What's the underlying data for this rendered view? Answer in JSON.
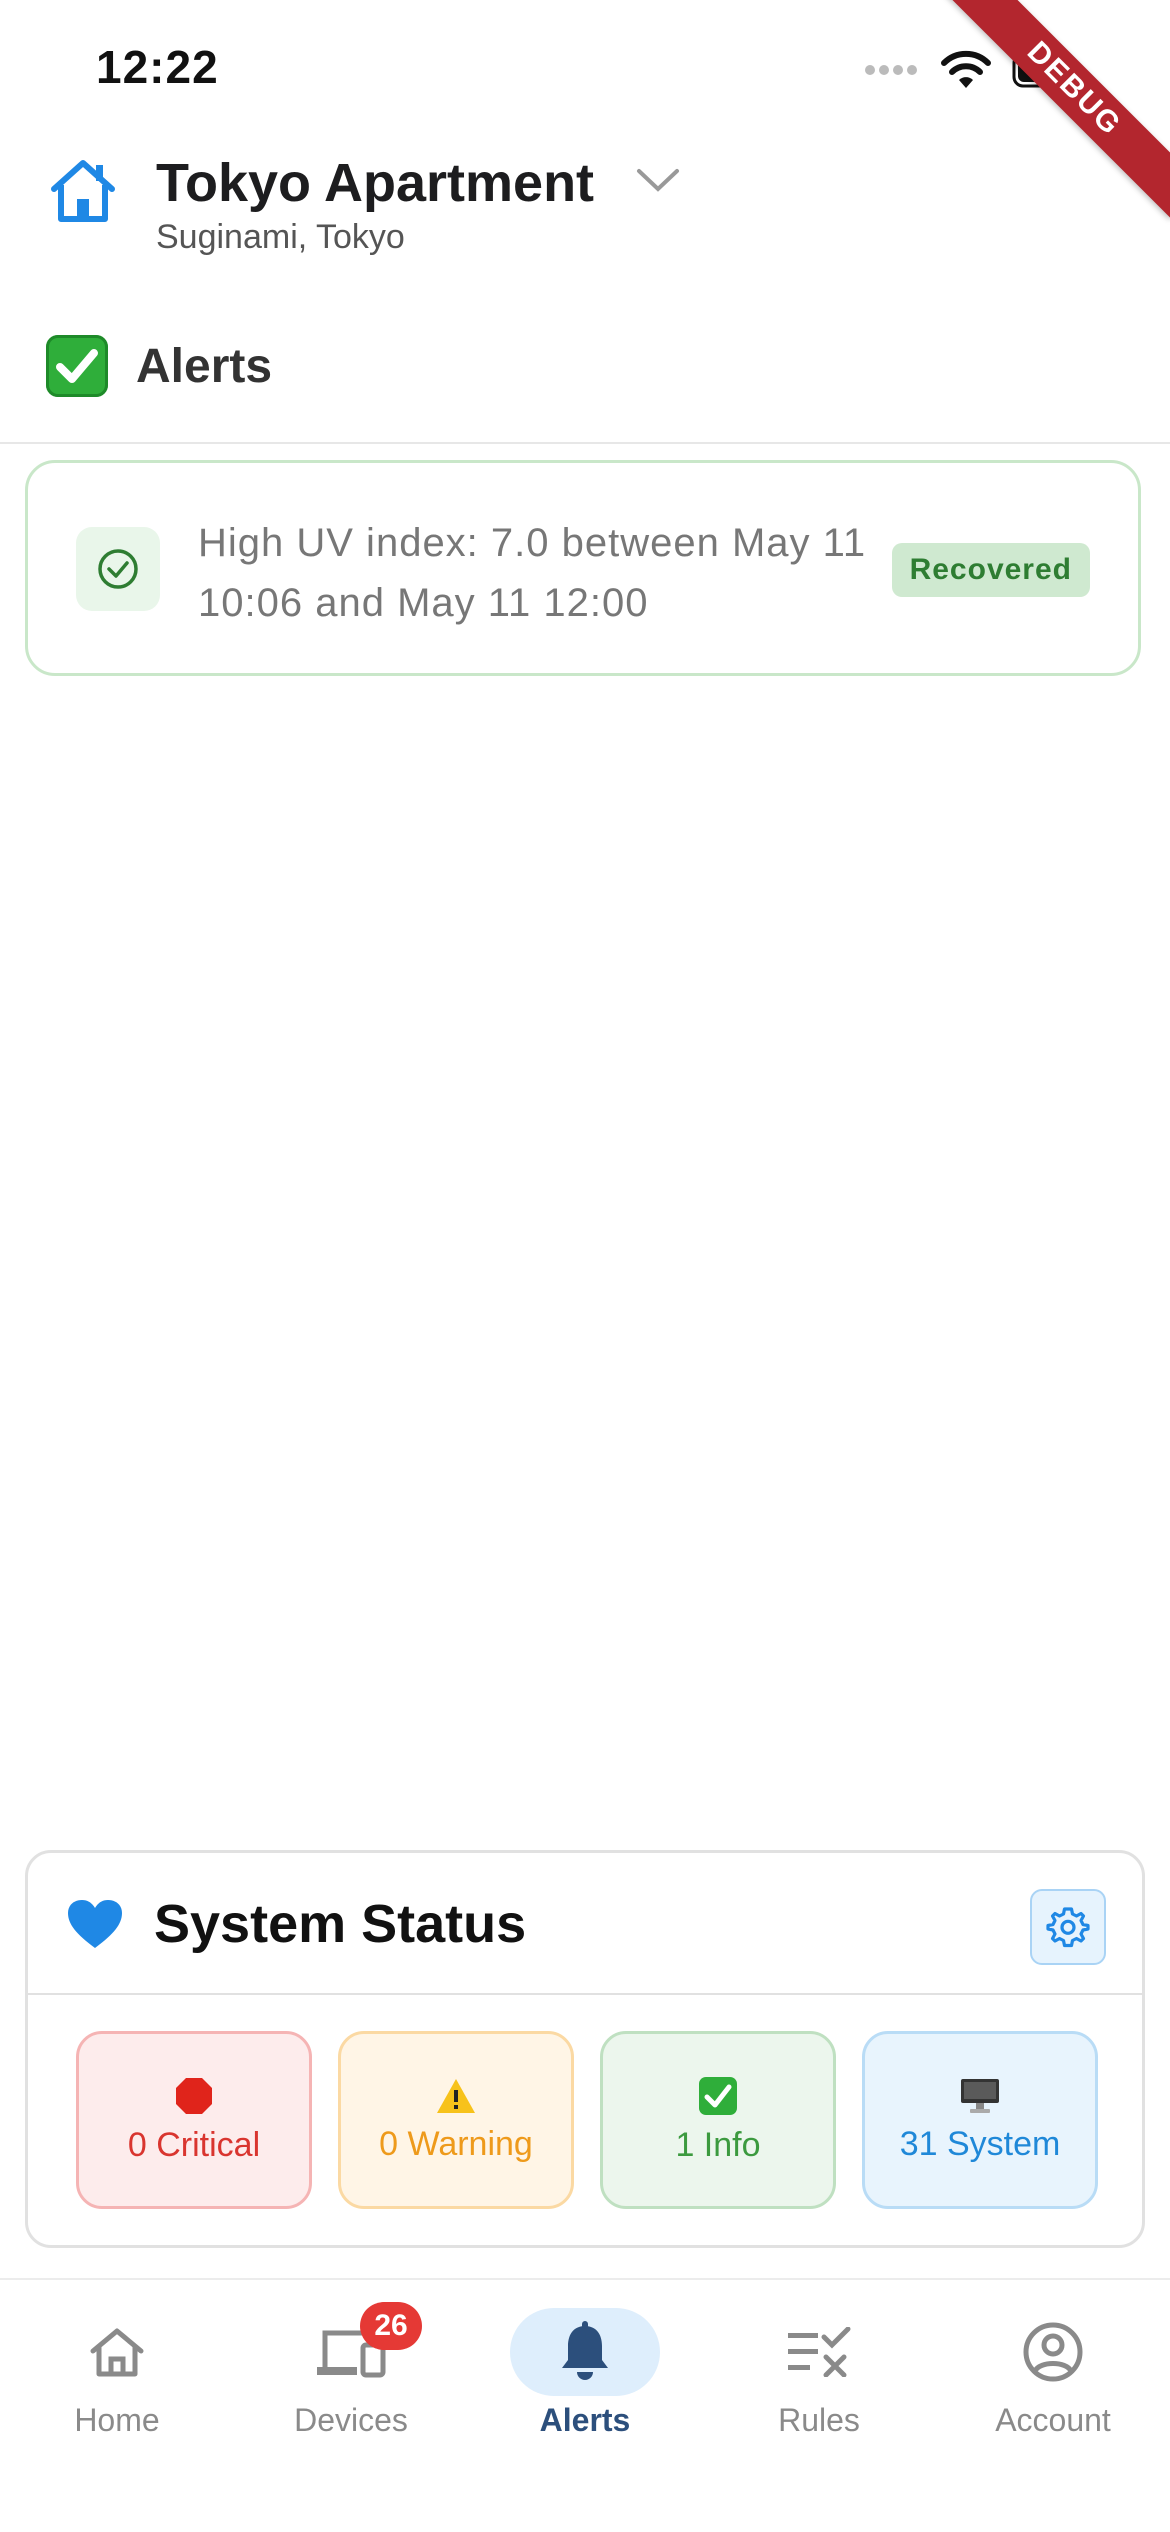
{
  "status_bar": {
    "time": "12:22",
    "debug_banner": "DEBUG"
  },
  "header": {
    "title": "Tokyo Apartment",
    "subtitle": "Suginami, Tokyo",
    "brand_color": "#1f88e5"
  },
  "alerts_section": {
    "title": "Alerts",
    "items": [
      {
        "text": "High UV index: 7.0 between May 11 10:06 and May 11 12:00",
        "status": "Recovered"
      }
    ]
  },
  "system_status": {
    "title": "System Status",
    "tiles": [
      {
        "label": "0 Critical",
        "icon": "stop-sign-icon",
        "color": "#d9352f"
      },
      {
        "label": "0 Warning",
        "icon": "warning-icon",
        "color": "#ee9a1b"
      },
      {
        "label": "1 Info",
        "icon": "check-box-icon",
        "color": "#3c9a3f"
      },
      {
        "label": "31 System",
        "icon": "monitor-icon",
        "color": "#1f88d8"
      }
    ]
  },
  "nav": {
    "items": [
      {
        "label": "Home",
        "icon": "home-icon"
      },
      {
        "label": "Devices",
        "icon": "devices-icon",
        "badge": "26"
      },
      {
        "label": "Alerts",
        "icon": "bell-icon",
        "active": true
      },
      {
        "label": "Rules",
        "icon": "rules-icon"
      },
      {
        "label": "Account",
        "icon": "account-icon"
      }
    ]
  }
}
